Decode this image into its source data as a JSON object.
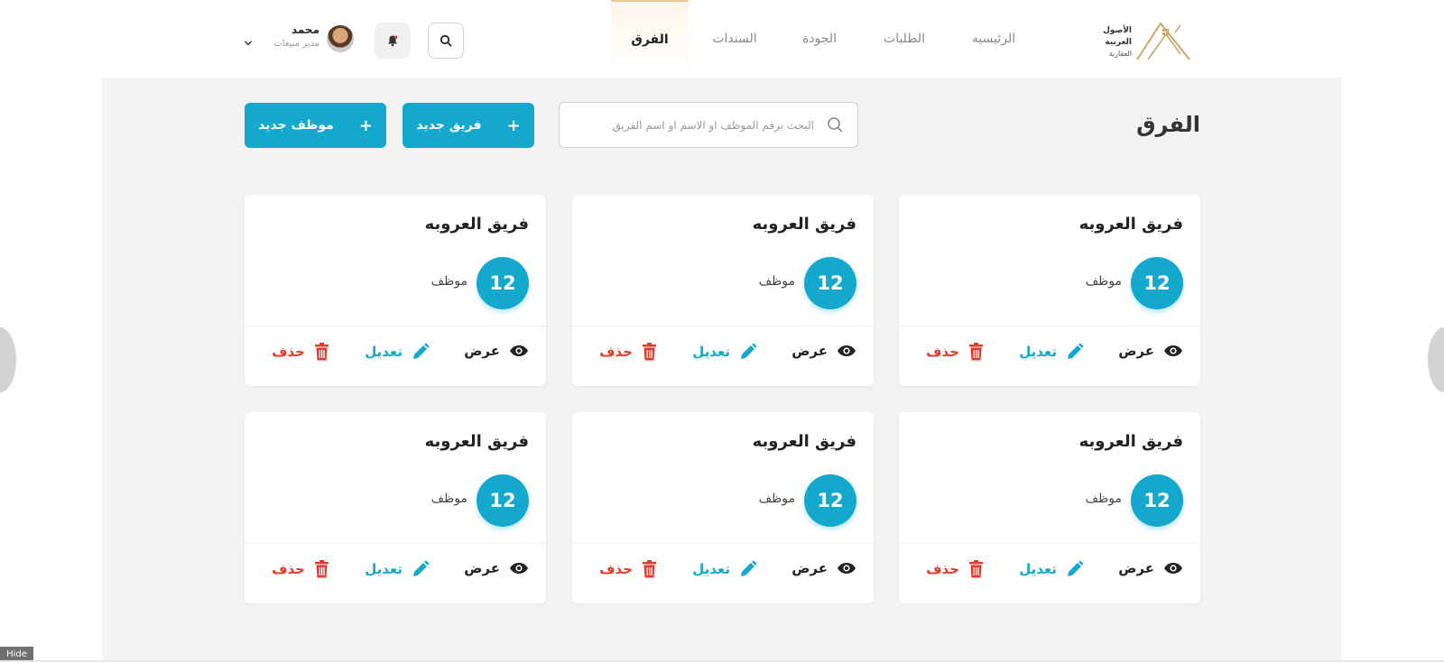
{
  "brand": {
    "line1": "الأصول العربية",
    "line2": "العقارية"
  },
  "nav": [
    {
      "label": "الرئيسيه"
    },
    {
      "label": "الطلبات"
    },
    {
      "label": "الجودة"
    },
    {
      "label": "السندات"
    },
    {
      "label": "الفرق"
    }
  ],
  "user": {
    "name": "محمد",
    "role": "مدير مبيعات"
  },
  "page": {
    "title": "الفرق"
  },
  "search": {
    "placeholder": "البحث برقم الموظف او الاسم او اسم الفريق"
  },
  "buttons": {
    "new_team": "فريق جديد",
    "new_employee": "موظف جديد",
    "plus": "+"
  },
  "cards": [
    {
      "title": "فريق العروبه",
      "count": "12",
      "count_label": "موظف",
      "view": "عرض",
      "edit": "تعديل",
      "delete": "حذف"
    },
    {
      "title": "فريق العروبه",
      "count": "12",
      "count_label": "موظف",
      "view": "عرض",
      "edit": "تعديل",
      "delete": "حذف"
    },
    {
      "title": "فريق العروبه",
      "count": "12",
      "count_label": "موظف",
      "view": "عرض",
      "edit": "تعديل",
      "delete": "حذف"
    },
    {
      "title": "فريق العروبه",
      "count": "12",
      "count_label": "موظف",
      "view": "عرض",
      "edit": "تعديل",
      "delete": "حذف"
    },
    {
      "title": "فريق العروبه",
      "count": "12",
      "count_label": "موظف",
      "view": "عرض",
      "edit": "تعديل",
      "delete": "حذف"
    },
    {
      "title": "فريق العروبه",
      "count": "12",
      "count_label": "موظف",
      "view": "عرض",
      "edit": "تعديل",
      "delete": "حذف"
    }
  ],
  "hide_label": "Hide",
  "colors": {
    "accent": "#14a9cc",
    "danger": "#e23b2e",
    "brand_gold": "#c9a86b"
  },
  "icons": {
    "logo": "house-roof-logo",
    "search": "search-icon",
    "bell": "bell-icon",
    "view": "eye-icon",
    "edit": "pencil-icon",
    "delete": "trash-icon",
    "chevron": "chevron-down-icon"
  }
}
